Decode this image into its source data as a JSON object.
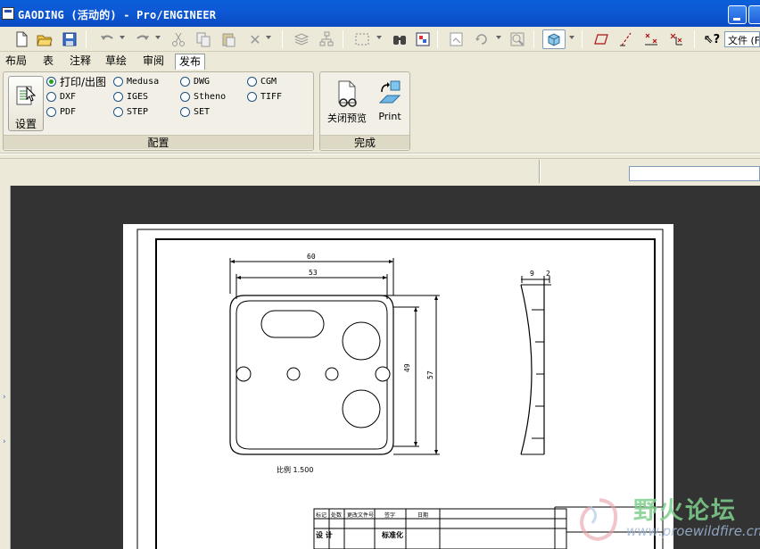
{
  "window": {
    "title": "GAODING (活动的) - Pro/ENGINEER"
  },
  "toolbar": {
    "file_label": "文件 (F"
  },
  "tabs": [
    {
      "label": "布局"
    },
    {
      "label": "表"
    },
    {
      "label": "注释"
    },
    {
      "label": "草绘"
    },
    {
      "label": "审阅"
    },
    {
      "label": "发布",
      "active": true
    }
  ],
  "ribbon": {
    "config_group": {
      "label": "配置",
      "setup_label": "设置",
      "options": [
        {
          "label": "打印/出图",
          "checked": true
        },
        {
          "label": "DXF"
        },
        {
          "label": "PDF"
        },
        {
          "label": "Medusa"
        },
        {
          "label": "IGES"
        },
        {
          "label": "STEP"
        },
        {
          "label": "DWG"
        },
        {
          "label": "Stheno"
        },
        {
          "label": "SET"
        },
        {
          "label": "CGM"
        },
        {
          "label": "TIFF"
        }
      ]
    },
    "finish_group": {
      "label": "完成",
      "close_preview_label": "关闭预览",
      "print_label": "Print"
    }
  },
  "drawing": {
    "dim_60": "60",
    "dim_53": "53",
    "dim_49": "49",
    "dim_57": "57",
    "dim_9": "9",
    "dim_2": "2",
    "scale_note": "比例 1.500",
    "title_block": {
      "row1": [
        "标记",
        "处数",
        "更改文件号",
        "签字",
        "日期"
      ],
      "row2": [
        "设 计",
        "",
        "标准化",
        "",
        ""
      ]
    }
  },
  "watermark": {
    "text": "野火论坛",
    "url": "www.proewildfire.cn"
  },
  "colors": {
    "titlebar": "#0a5fd8",
    "canvas": "#333333",
    "radio_checked": "#21a121"
  }
}
